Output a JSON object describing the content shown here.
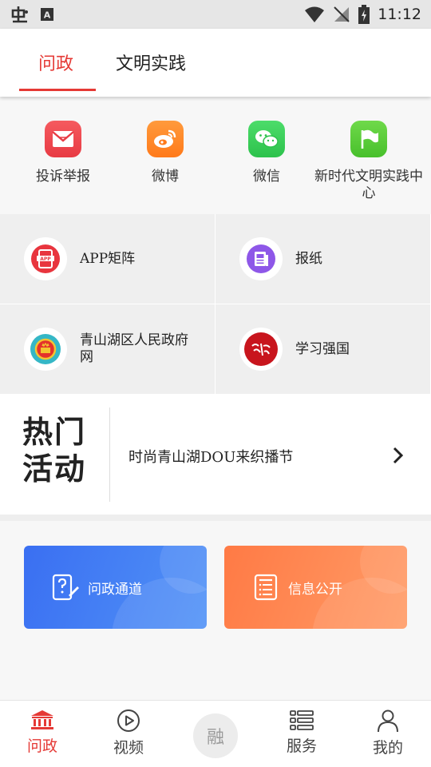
{
  "status_bar": {
    "time": "11:12"
  },
  "header": {
    "tabs": [
      {
        "label": "问政",
        "active": true
      },
      {
        "label": "文明实践",
        "active": false
      }
    ],
    "accent_color": "#e53935"
  },
  "channels": [
    {
      "label": "投诉举报",
      "icon": "envelope-icon",
      "color": "#f0474f"
    },
    {
      "label": "微博",
      "icon": "weibo-icon",
      "color": "#ff8a2b"
    },
    {
      "label": "微信",
      "icon": "wechat-icon",
      "color": "#3ccf5a"
    },
    {
      "label": "新时代文明实践中心",
      "icon": "flag-icon",
      "color": "#5fcc3c"
    }
  ],
  "grid": [
    {
      "label": "APP矩阵",
      "icon": "app-matrix-icon"
    },
    {
      "label": "报纸",
      "icon": "newspaper-icon"
    },
    {
      "label": "青山湖区人民政府网",
      "icon": "national-emblem-icon"
    },
    {
      "label": "学习强国",
      "icon": "xuexi-qiangguo-icon"
    }
  ],
  "hot_activity": {
    "title_line1": "热门",
    "title_line2": "活动",
    "item": "时尚青山湖DOU来织播节"
  },
  "cards": [
    {
      "label": "问政通道",
      "icon": "question-phone-icon",
      "color": "#4a86f5"
    },
    {
      "label": "信息公开",
      "icon": "document-list-icon",
      "color": "#ff8a55"
    }
  ],
  "bottom_nav": [
    {
      "label": "问政",
      "icon": "government-building-icon",
      "active": true
    },
    {
      "label": "视频",
      "icon": "play-circle-icon",
      "active": false
    },
    {
      "label": "融",
      "icon": "rong-center-icon",
      "active": false
    },
    {
      "label": "服务",
      "icon": "service-list-icon",
      "active": false
    },
    {
      "label": "我的",
      "icon": "user-icon",
      "active": false
    }
  ]
}
